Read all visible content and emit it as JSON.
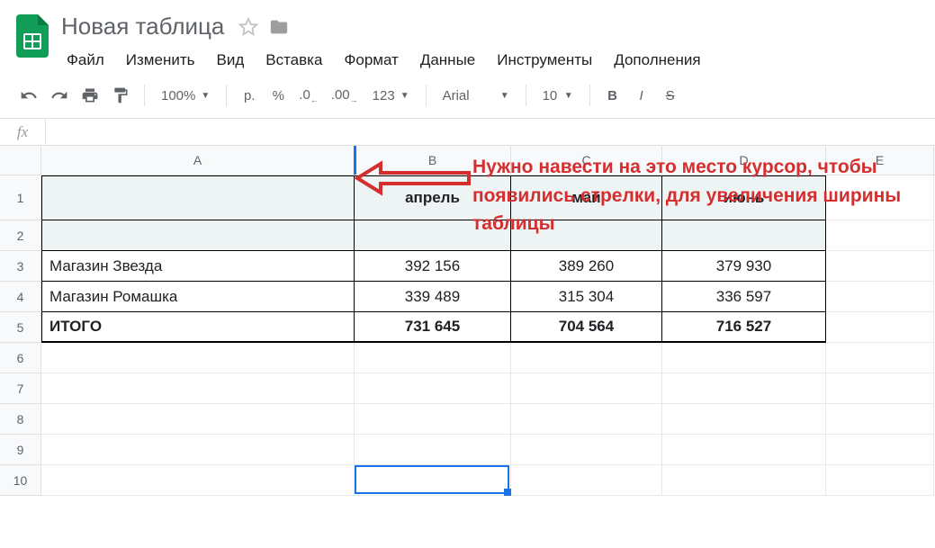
{
  "doc": {
    "title": "Новая таблица"
  },
  "menu": [
    "Файл",
    "Изменить",
    "Вид",
    "Вставка",
    "Формат",
    "Данные",
    "Инструменты",
    "Дополнения"
  ],
  "toolbar": {
    "zoom": "100%",
    "currency": "р.",
    "percent": "%",
    "dec_less": ".0",
    "dec_more": ".00",
    "fmt_more": "123",
    "font": "Arial",
    "size": "10",
    "bold": "B",
    "italic": "I",
    "strike": "S"
  },
  "formula_label": "fx",
  "columns": [
    "A",
    "B",
    "C",
    "D",
    "E"
  ],
  "rows": [
    "1",
    "2",
    "3",
    "4",
    "5",
    "6",
    "7",
    "8",
    "9",
    "10"
  ],
  "table": {
    "headers": {
      "A": "",
      "B": "апрель",
      "C": "май",
      "D": "июнь"
    },
    "data": [
      {
        "A": "Магазин Звезда",
        "B": "392 156",
        "C": "389 260",
        "D": "379 930"
      },
      {
        "A": "Магазин Ромашка",
        "B": "339 489",
        "C": "315 304",
        "D": "336 597"
      }
    ],
    "total": {
      "A": "ИТОГО",
      "B": "731 645",
      "C": "704 564",
      "D": "716 527"
    }
  },
  "annotation": "Нужно навести на это место курсор, чтобы появились стрелки, для увеличения ширины таблицы",
  "colors": {
    "accent": "#1a73e8",
    "annotation": "#d32f2f",
    "logo": "#0F9D58"
  }
}
